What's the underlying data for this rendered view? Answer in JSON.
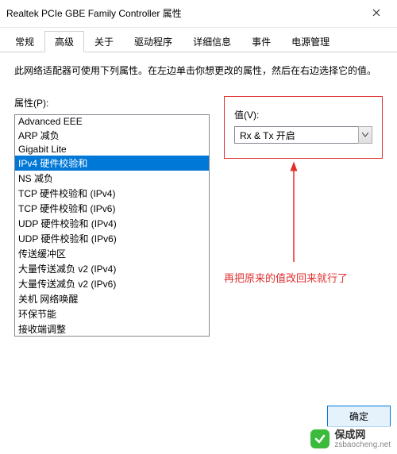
{
  "title": "Realtek PCIe GBE Family Controller 属性",
  "tabs": {
    "items": [
      "常规",
      "高级",
      "关于",
      "驱动程序",
      "详细信息",
      "事件",
      "电源管理"
    ],
    "active_index": 1
  },
  "description": "此网络适配器可使用下列属性。在左边单击你想更改的属性，然后在右边选择它的值。",
  "property": {
    "label": "属性(P):",
    "items": [
      "Advanced EEE",
      "ARP 减负",
      "Gigabit Lite",
      "IPv4 硬件校验和",
      "NS 减负",
      "TCP 硬件校验和 (IPv4)",
      "TCP 硬件校验和 (IPv6)",
      "UDP 硬件校验和 (IPv4)",
      "UDP 硬件校验和 (IPv6)",
      "传送缓冲区",
      "大量传送减负 v2 (IPv4)",
      "大量传送减负 v2 (IPv6)",
      "关机 网络唤醒",
      "环保节能",
      "接收端调整"
    ],
    "selected_index": 3
  },
  "value": {
    "label": "值(V):",
    "selected": "Rx & Tx 开启"
  },
  "annotation_text": "再把原来的值改回来就行了",
  "buttons": {
    "ok": "确定"
  },
  "watermark": {
    "name": "保成网",
    "url": "zsbaocheng.net"
  },
  "annotation_color": "#e03030"
}
